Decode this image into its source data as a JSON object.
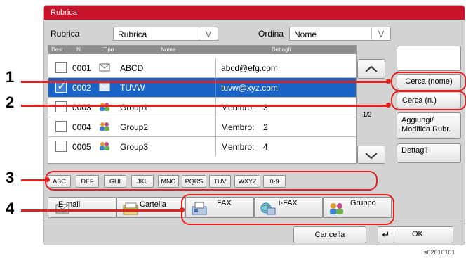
{
  "window": {
    "title": "Rubrica"
  },
  "filter": {
    "rubrica_label": "Rubrica",
    "rubrica_value": "Rubrica",
    "ordina_label": "Ordina",
    "ordina_value": "Nome"
  },
  "columns": {
    "dest": "Dest.",
    "n": "N.",
    "tipo": "Tipo",
    "nome": "Nome",
    "dettagli": "Dettagli"
  },
  "rows": [
    {
      "num": "0001",
      "type_icon": "email-icon",
      "name": "ABCD",
      "detail": "abcd@efg.com",
      "member_count": "",
      "selected": false
    },
    {
      "num": "0002",
      "type_icon": "email-icon",
      "name": "TUVW",
      "detail": "tuvw@xyz.com",
      "member_count": "",
      "selected": true
    },
    {
      "num": "0003",
      "type_icon": "group-icon",
      "name": "Group1",
      "detail": "Membro:",
      "member_count": "3",
      "selected": false
    },
    {
      "num": "0004",
      "type_icon": "group-icon",
      "name": "Group2",
      "detail": "Membro:",
      "member_count": "2",
      "selected": false
    },
    {
      "num": "0005",
      "type_icon": "group-icon",
      "name": "Group3",
      "detail": "Membro:",
      "member_count": "4",
      "selected": false
    }
  ],
  "page_indicator": "1/2",
  "side_buttons": {
    "search_name": "Cerca (nome)",
    "search_num": "Cerca (n.)",
    "add_edit_line1": "Aggiungi/",
    "add_edit_line2": "Modifica Rubr.",
    "details": "Dettagli"
  },
  "index_keys": [
    "ABC",
    "DEF",
    "GHI",
    "JKL",
    "MNO",
    "PQRS",
    "TUV",
    "WXYZ",
    "0-9"
  ],
  "type_tabs": [
    "E-mail",
    "Cartella",
    "FAX",
    "i-FAX",
    "Gruppo"
  ],
  "footer": {
    "cancel": "Cancella",
    "ok": "OK"
  },
  "callouts": [
    "1",
    "2",
    "3",
    "4"
  ],
  "image_code": "s02010101",
  "colors": {
    "title_bar": "#c8132a",
    "selection": "#1a63c6",
    "callout": "#e0211d",
    "dialog_bg": "#d3d3d3"
  }
}
